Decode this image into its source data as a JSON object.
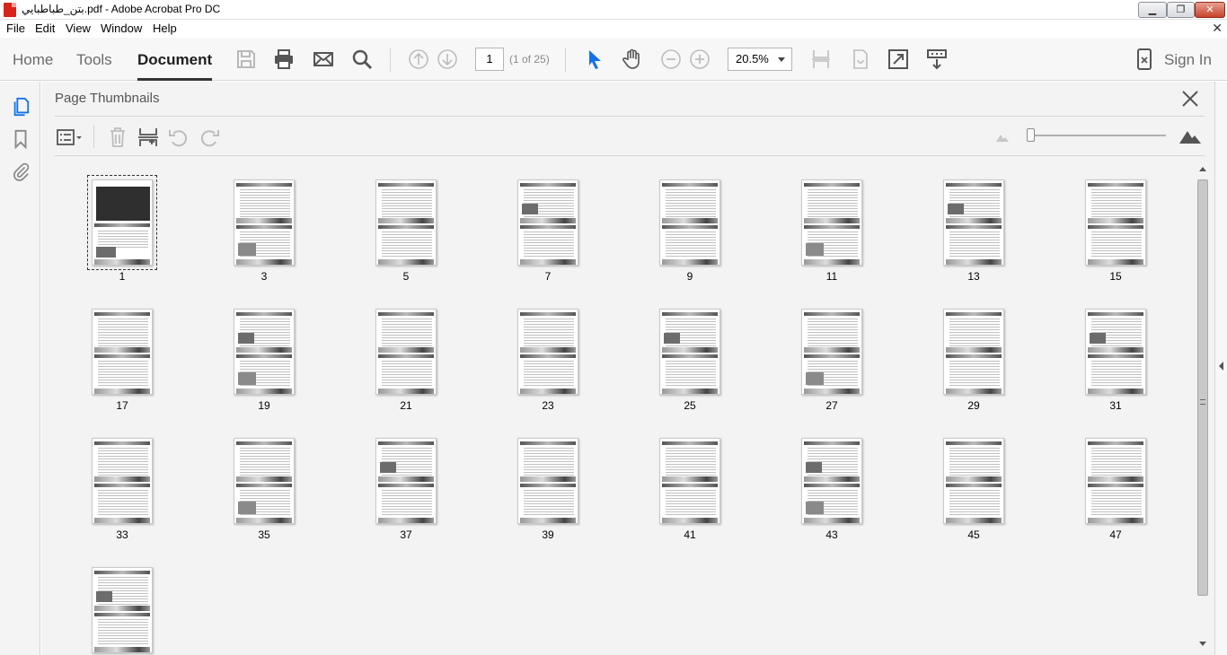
{
  "window": {
    "title": "بتن_طباطبايي.pdf - Adobe Acrobat Pro DC",
    "min_label": "▁",
    "max_label": "❐",
    "close_label": "✕"
  },
  "menu": {
    "items": [
      "File",
      "Edit",
      "View",
      "Window",
      "Help"
    ],
    "close_glyph": "✕"
  },
  "toolbar": {
    "tabs": [
      "Home",
      "Tools",
      "Document"
    ],
    "active_tab": "Document",
    "page_number": "1",
    "page_count": "(1 of 25)",
    "zoom": "20.5%",
    "sign_in": "Sign In"
  },
  "panel": {
    "title": "Page Thumbnails"
  },
  "thumbnails": {
    "labels": [
      "1",
      "3",
      "5",
      "7",
      "9",
      "11",
      "13",
      "15",
      "17",
      "19",
      "21",
      "23",
      "25",
      "27",
      "29",
      "31",
      "33",
      "35",
      "37",
      "39",
      "41",
      "43",
      "45",
      "47",
      ""
    ],
    "selected": "1"
  },
  "icons": {
    "save": "save-icon",
    "print": "print-icon",
    "email": "email-icon",
    "search": "search-icon",
    "prev_page": "arrow-up-circle-icon",
    "next_page": "arrow-down-circle-icon",
    "select": "pointer-icon",
    "hand": "hand-icon",
    "zoom_out": "minus-circle-icon",
    "zoom_in": "plus-circle-icon"
  },
  "colors": {
    "toolbar_bg": "#f7f7f7",
    "panel_bg": "#f3f3f3",
    "accent_blue": "#1473e6"
  }
}
